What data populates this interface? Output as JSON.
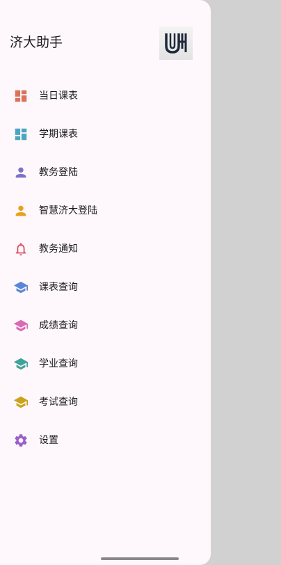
{
  "drawer": {
    "title": "济大助手",
    "logo": {
      "icon": "uj-logo-icon",
      "color": "#1e2a3a"
    }
  },
  "menu": [
    {
      "label": "当日课表",
      "icon": "dashboard-icon",
      "color": "#d9735c"
    },
    {
      "label": "学期课表",
      "icon": "dashboard-icon",
      "color": "#4aa6bf"
    },
    {
      "label": "教务登陆",
      "icon": "person-icon",
      "color": "#7d72c8"
    },
    {
      "label": "智慧济大登陆",
      "icon": "person-icon",
      "color": "#e6a21c"
    },
    {
      "label": "教务通知",
      "icon": "bell-icon",
      "color": "#d9556a"
    },
    {
      "label": "课表查询",
      "icon": "school-icon",
      "color": "#5b86d6"
    },
    {
      "label": "成绩查询",
      "icon": "school-icon",
      "color": "#d96ab3"
    },
    {
      "label": "学业查询",
      "icon": "school-icon",
      "color": "#3fa39a"
    },
    {
      "label": "考试查询",
      "icon": "school-icon",
      "color": "#c9a319"
    },
    {
      "label": "设置",
      "icon": "gear-icon",
      "color": "#9b5fc6"
    }
  ]
}
